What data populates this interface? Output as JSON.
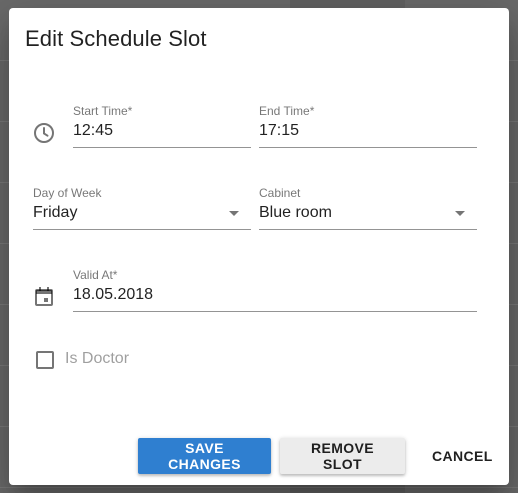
{
  "dialog": {
    "title": "Edit Schedule Slot"
  },
  "fields": {
    "start_time": {
      "label": "Start Time*",
      "value": "12:45"
    },
    "end_time": {
      "label": "End Time*",
      "value": "17:15"
    },
    "day_of_week": {
      "label": "Day of Week",
      "value": "Friday"
    },
    "cabinet": {
      "label": "Cabinet",
      "value": "Blue room"
    },
    "valid_at": {
      "label": "Valid At*",
      "value": "18.05.2018"
    }
  },
  "checkbox": {
    "label": "Is Doctor",
    "checked": false
  },
  "buttons": {
    "save": "SAVE CHANGES",
    "remove": "REMOVE SLOT",
    "cancel": "CANCEL"
  },
  "icons": {
    "time": "clock-icon",
    "date": "calendar-icon",
    "dropdown": "chevron-down-icon"
  },
  "colors": {
    "primary": "#2f7fd0"
  }
}
